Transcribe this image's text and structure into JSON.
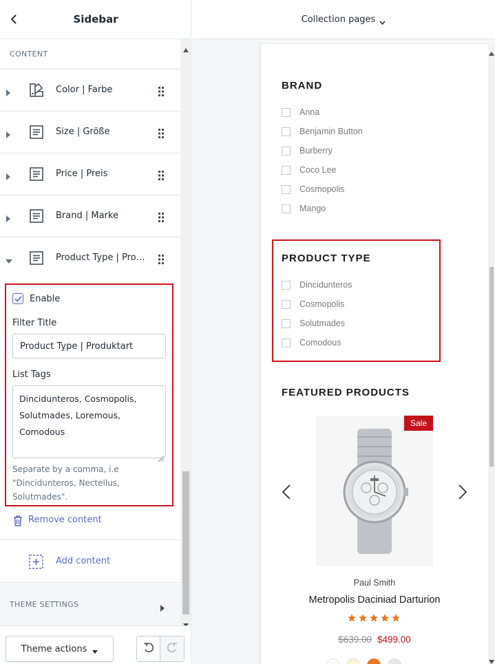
{
  "sidebar": {
    "title": "Sidebar",
    "section_label": "CONTENT",
    "blocks": [
      {
        "label": "Color | Farbe",
        "icon": "color-swatch-icon"
      },
      {
        "label": "Size | Größe",
        "icon": "text-block-icon"
      },
      {
        "label": "Price | Preis",
        "icon": "text-block-icon"
      },
      {
        "label": "Brand | Marke",
        "icon": "text-block-icon"
      },
      {
        "label": "Product Type | Produktart",
        "icon": "text-block-icon"
      }
    ],
    "settings": {
      "enable_label": "Enable",
      "enable_checked": true,
      "filter_title_label": "Filter Title",
      "filter_title_value": "Product Type | Produktart",
      "list_tags_label": "List Tags",
      "list_tags_value": "Dincidunteros, Cosmopolis, Solutmades, Loremous, Comodous",
      "help_text": "Separate by a comma, i.e \"Dincidunteros, Nectellus, Solutmades\"."
    },
    "remove_label": "Remove content",
    "add_label": "Add content",
    "theme_settings_label": "THEME SETTINGS",
    "theme_actions_label": "Theme actions"
  },
  "topbar": {
    "page_select": "Collection pages"
  },
  "preview": {
    "brand_heading": "BRAND",
    "brands": [
      "Anna",
      "Benjamin Button",
      "Burberry",
      "Coco Lee",
      "Cosmopolis",
      "Mango"
    ],
    "product_type_heading": "PRODUCT TYPE",
    "product_types": [
      "Dincidunteros",
      "Cosmopolis",
      "Solutmades",
      "Comodous"
    ],
    "featured_heading": "FEATURED PRODUCTS",
    "product": {
      "badge": "Sale",
      "vendor": "Paul Smith",
      "title": "Metropolis Daciniad Darturion",
      "rating": 5,
      "old_price": "$639.00",
      "new_price": "$499.00"
    }
  },
  "colors": {
    "accent": "#5c6ac4",
    "highlight": "#d0121b",
    "sale": "#c4121b",
    "star": "#e87722"
  }
}
